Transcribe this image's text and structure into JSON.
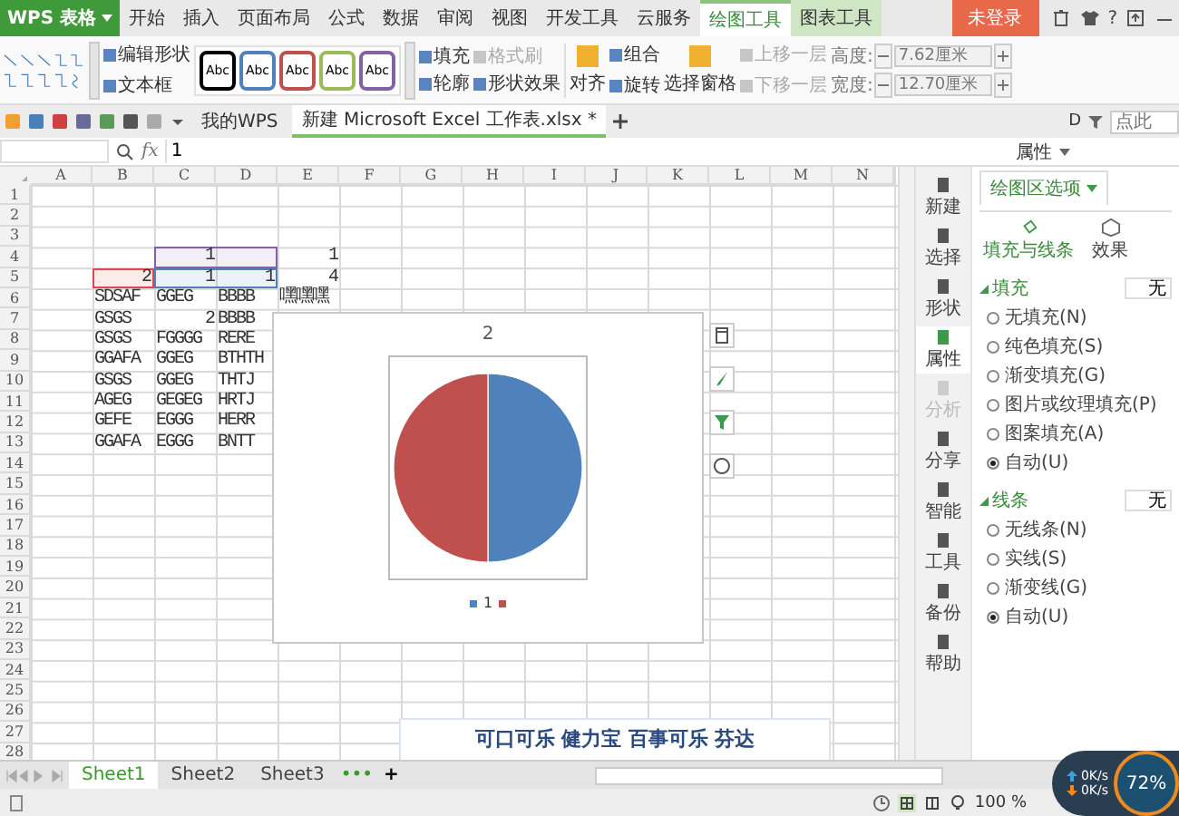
{
  "app_menu": {
    "label": "WPS 表格"
  },
  "menu_tabs": [
    {
      "label": "开始",
      "selected": false,
      "kind": "normal"
    },
    {
      "label": "插入",
      "selected": false,
      "kind": "normal"
    },
    {
      "label": "页面布局",
      "selected": false,
      "kind": "normal"
    },
    {
      "label": "公式",
      "selected": false,
      "kind": "normal"
    },
    {
      "label": "数据",
      "selected": false,
      "kind": "normal"
    },
    {
      "label": "审阅",
      "selected": false,
      "kind": "normal"
    },
    {
      "label": "视图",
      "selected": false,
      "kind": "normal"
    },
    {
      "label": "开发工具",
      "selected": false,
      "kind": "normal"
    },
    {
      "label": "云服务",
      "selected": false,
      "kind": "normal"
    },
    {
      "label": "绘图工具",
      "selected": true,
      "kind": "context"
    },
    {
      "label": "图表工具",
      "selected": false,
      "kind": "context"
    }
  ],
  "login_button": "未登录",
  "help_button": "?",
  "ribbon": {
    "shape_commands": [
      {
        "label": "编辑形状",
        "disabled": false
      },
      {
        "label": "文本框",
        "disabled": false
      }
    ],
    "style_presets": [
      {
        "label": "Abc",
        "color": "#000000"
      },
      {
        "label": "Abc",
        "color": "#4f81bd"
      },
      {
        "label": "Abc",
        "color": "#c0504d"
      },
      {
        "label": "Abc",
        "color": "#9bbb59"
      },
      {
        "label": "Abc",
        "color": "#8064a2"
      }
    ],
    "format_commands": [
      {
        "label": "填充",
        "disabled": false
      },
      {
        "label": "轮廓",
        "disabled": false
      },
      {
        "label": "格式刷",
        "disabled": true
      },
      {
        "label": "形状效果",
        "disabled": false
      }
    ],
    "arrange_commands": [
      {
        "label": "对齐",
        "kind": "large",
        "disabled": false
      },
      {
        "label": "组合",
        "kind": "small",
        "disabled": false
      },
      {
        "label": "旋转",
        "kind": "small",
        "disabled": false
      },
      {
        "label": "选择窗格",
        "kind": "large",
        "disabled": false
      },
      {
        "label": "上移一层",
        "kind": "small",
        "disabled": true
      },
      {
        "label": "下移一层",
        "kind": "small",
        "disabled": true
      }
    ],
    "size_fields": [
      {
        "label": "高度:",
        "value": "7.62厘米",
        "disabled": true
      },
      {
        "label": "宽度:",
        "value": "12.70厘米",
        "disabled": true
      }
    ]
  },
  "doc_tabs": [
    {
      "label": "我的WPS",
      "selected": false
    },
    {
      "label": "新建 Microsoft Excel 工作表.xlsx *",
      "selected": true
    }
  ],
  "toolbar_letter": "D",
  "search": {
    "placeholder": "点此"
  },
  "formula_bar": {
    "fx_label": "fx",
    "value": "1"
  },
  "sheet": {
    "columns": [
      "A",
      "B",
      "C",
      "D",
      "E",
      "F",
      "G",
      "H",
      "I",
      "J",
      "K",
      "L",
      "M",
      "N"
    ],
    "rows": [
      {
        "label": "1"
      },
      {
        "label": "2"
      },
      {
        "label": "3"
      },
      {
        "label": "4",
        "cells": [
          null,
          null,
          {
            "text": "1",
            "kind": "number",
            "color": "#8064a2"
          },
          {
            "color": "#8064a2"
          },
          {
            "text": "1",
            "kind": "number"
          }
        ]
      },
      {
        "label": "5",
        "cells": [
          null,
          {
            "text": "2",
            "kind": "number",
            "color": "#e0474c"
          },
          {
            "text": "1",
            "kind": "number",
            "color": "#4f81bd"
          },
          {
            "text": "1",
            "kind": "number",
            "color": "#4f81bd"
          },
          {
            "text": "4",
            "kind": "number"
          }
        ]
      },
      {
        "label": "6",
        "cells": [
          null,
          {
            "text": "SDSAF",
            "kind": "text"
          },
          {
            "text": "GGEG",
            "kind": "text"
          },
          {
            "text": "BBBB",
            "kind": "text"
          },
          {
            "text": "嘿嘿嘿",
            "kind": "text"
          }
        ]
      },
      {
        "label": "7",
        "cells": [
          null,
          {
            "text": "GSGS",
            "kind": "text"
          },
          {
            "text": "2",
            "kind": "number"
          },
          {
            "text": "BBBB",
            "kind": "text"
          }
        ]
      },
      {
        "label": "8",
        "cells": [
          null,
          {
            "text": "GSGS",
            "kind": "text"
          },
          {
            "text": "FGGGG",
            "kind": "text"
          },
          {
            "text": "RERE",
            "kind": "text"
          }
        ]
      },
      {
        "label": "9",
        "cells": [
          null,
          {
            "text": "GGAFA",
            "kind": "text"
          },
          {
            "text": "GGEG",
            "kind": "text"
          },
          {
            "text": "BTHTH",
            "kind": "text"
          }
        ]
      },
      {
        "label": "10",
        "cells": [
          null,
          {
            "text": "GSGS",
            "kind": "text"
          },
          {
            "text": "GGEG",
            "kind": "text"
          },
          {
            "text": "THTJ",
            "kind": "text"
          }
        ]
      },
      {
        "label": "11",
        "cells": [
          null,
          {
            "text": "AGEG",
            "kind": "text"
          },
          {
            "text": "GEGEG",
            "kind": "text"
          },
          {
            "text": "HRTJ",
            "kind": "text"
          }
        ]
      },
      {
        "label": "12",
        "cells": [
          null,
          {
            "text": "GEFE",
            "kind": "text"
          },
          {
            "text": "EGGG",
            "kind": "text"
          },
          {
            "text": "HERR",
            "kind": "text"
          }
        ]
      },
      {
        "label": "13",
        "cells": [
          null,
          {
            "text": "GGAFA",
            "kind": "text"
          },
          {
            "text": "EGGG",
            "kind": "text"
          },
          {
            "text": "BNTT",
            "kind": "text"
          }
        ]
      },
      {
        "label": "14"
      },
      {
        "label": "15"
      },
      {
        "label": "16"
      },
      {
        "label": "17"
      },
      {
        "label": "18"
      },
      {
        "label": "19"
      },
      {
        "label": "20"
      },
      {
        "label": "21"
      },
      {
        "label": "22"
      },
      {
        "label": "23"
      },
      {
        "label": "24"
      },
      {
        "label": "25"
      },
      {
        "label": "26"
      },
      {
        "label": "27"
      },
      {
        "label": "28"
      }
    ]
  },
  "chart": {
    "chart_data": {
      "type": "pie",
      "title": "2",
      "categories": [
        "1",
        null
      ],
      "values": [
        1,
        1
      ],
      "colors": [
        "#4f81bd",
        "#c0504d"
      ]
    }
  },
  "second_chart": {
    "title": "可口可乐 健力宝 百事可乐 芬达"
  },
  "sidebar": {
    "items": [
      {
        "label": "新建",
        "selected": false,
        "disabled": false
      },
      {
        "label": "选择",
        "selected": false,
        "disabled": false
      },
      {
        "label": "形状",
        "selected": false,
        "disabled": false
      },
      {
        "label": "属性",
        "selected": true,
        "disabled": false
      },
      {
        "label": "分析",
        "selected": false,
        "disabled": true
      },
      {
        "label": "分享",
        "selected": false,
        "disabled": false
      },
      {
        "label": "智能",
        "selected": false,
        "disabled": false
      },
      {
        "label": "工具",
        "selected": false,
        "disabled": false
      },
      {
        "label": "备份",
        "selected": false,
        "disabled": false
      },
      {
        "label": "帮助",
        "selected": false,
        "disabled": false
      }
    ]
  },
  "panel": {
    "title": "属性",
    "dropdown": "绘图区选项",
    "tabs": [
      {
        "label": "填充与线条",
        "selected": true
      },
      {
        "label": "效果",
        "selected": false
      }
    ],
    "sections": [
      {
        "title": "填充",
        "value": "无",
        "options": [
          {
            "label": "无填充(N)",
            "selected": false
          },
          {
            "label": "纯色填充(S)",
            "selected": false
          },
          {
            "label": "渐变填充(G)",
            "selected": false
          },
          {
            "label": "图片或纹理填充(P)",
            "selected": false
          },
          {
            "label": "图案填充(A)",
            "selected": false
          },
          {
            "label": "自动(U)",
            "selected": true
          }
        ]
      },
      {
        "title": "线条",
        "value": "无",
        "options": [
          {
            "label": "无线条(N)",
            "selected": false
          },
          {
            "label": "实线(S)",
            "selected": false
          },
          {
            "label": "渐变线(G)",
            "selected": false
          },
          {
            "label": "自动(U)",
            "selected": true
          }
        ]
      }
    ]
  },
  "sheet_tabs": [
    {
      "label": "Sheet1",
      "selected": true
    },
    {
      "label": "Sheet2",
      "selected": false
    },
    {
      "label": "Sheet3",
      "selected": false
    }
  ],
  "more_sheets": "•••",
  "add_sheet": "+",
  "status_bar": {
    "zoom": "100 %"
  },
  "network_widget": {
    "upload": "0K/s",
    "download": "0K/s",
    "percent": "72%"
  }
}
